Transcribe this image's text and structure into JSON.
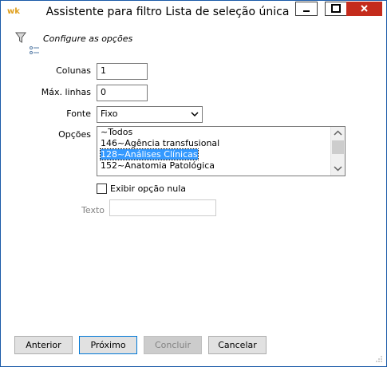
{
  "window": {
    "app_icon": "wk",
    "title": "Assistente para filtro Lista de seleção única",
    "controls": {
      "minimize": "minimize-icon",
      "maximize": "maximize-icon",
      "close": "close-icon"
    }
  },
  "header": {
    "text": "Configure as opções",
    "icon": "filter-icon"
  },
  "form": {
    "colunas_label": "Colunas",
    "colunas_value": "1",
    "max_linhas_label": "Máx. linhas",
    "max_linhas_value": "0",
    "fonte_label": "Fonte",
    "fonte_value": "Fixo",
    "opcoes_label": "Opções",
    "opcoes": [
      "~Todos",
      "146~Agência transfusional",
      "128~Análises Clínicas",
      "152~Anatomia Patológica"
    ],
    "selected_option": "128~Análises Clínicas",
    "exibir_label": "Exibir opção nula",
    "exibir_checked": false,
    "texto_label": "Texto",
    "texto_value": ""
  },
  "buttons": {
    "anterior": "Anterior",
    "proximo": "Próximo",
    "concluir": "Concluir",
    "cancelar": "Cancelar"
  },
  "colors": {
    "selection": "#3399ff",
    "close_button": "#c42b1c",
    "button_face": "#e1e1e1"
  }
}
